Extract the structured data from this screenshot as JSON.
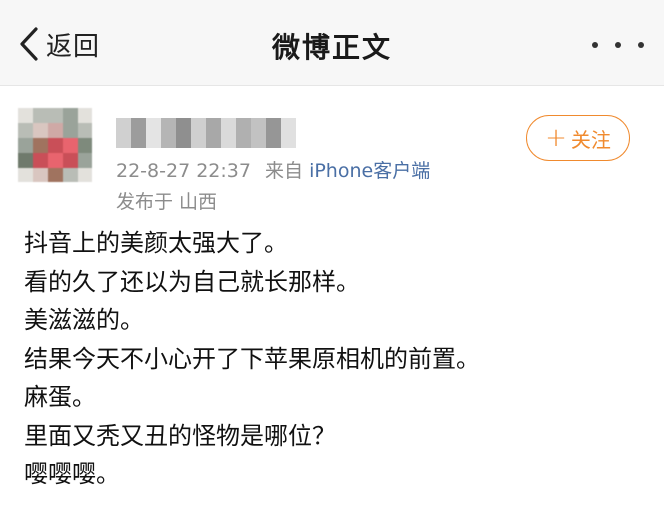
{
  "header": {
    "back_label": "返回",
    "title": "微博正文",
    "more_icon": "more-dots-icon"
  },
  "post": {
    "timestamp": "22-8-27 22:37",
    "source_prefix": "来自",
    "source": "iPhone客户端",
    "location": "发布于 山西",
    "follow_label": "关注",
    "content_lines": [
      "抖音上的美颜太强大了。",
      "看的久了还以为自己就长那样。",
      "美滋滋的。",
      "结果今天不小心开了下苹果原相机的前置。",
      "麻蛋。",
      "里面又秃又丑的怪物是哪位？",
      "嘤嘤嘤。"
    ]
  },
  "colors": {
    "accent": "#f08a2e",
    "link": "#4a6fa5",
    "meta": "#8c8c8c"
  }
}
